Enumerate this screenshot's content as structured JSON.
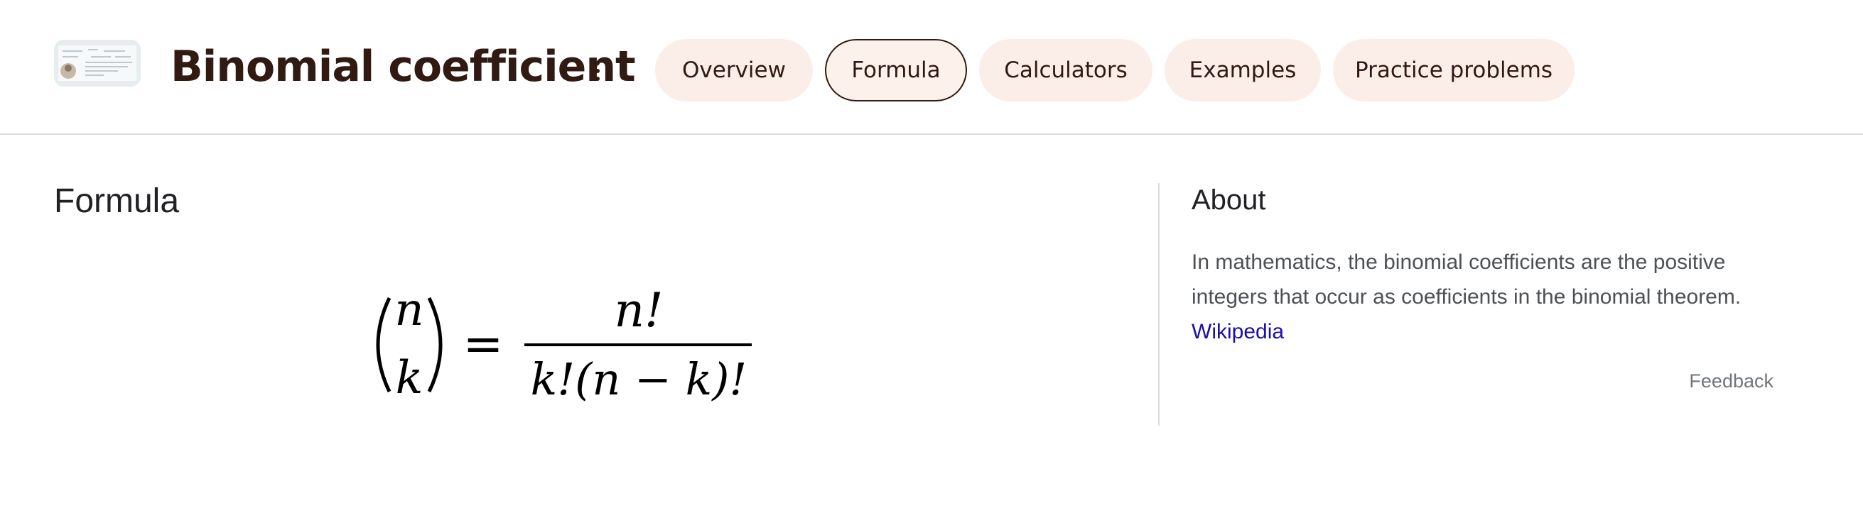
{
  "header": {
    "title": "Binomial coefficient",
    "tabs": [
      {
        "label": "Overview",
        "active": false
      },
      {
        "label": "Formula",
        "active": true
      },
      {
        "label": "Calculators",
        "active": false
      },
      {
        "label": "Examples",
        "active": false
      },
      {
        "label": "Practice problems",
        "active": false
      }
    ]
  },
  "main": {
    "section_title": "Formula",
    "formula": {
      "binom_top": "n",
      "binom_bottom": "k",
      "equals": "=",
      "numerator": "n!",
      "denominator": "k!(n − k)!"
    }
  },
  "about": {
    "title": "About",
    "description": "In mathematics, the binomial coefficients are the positive integers that occur as coefficients in the binomial theorem.",
    "source_link": "Wikipedia",
    "feedback": "Feedback"
  },
  "colors": {
    "title": "#301a12",
    "chip_background": "#fbeee8",
    "link": "#1a0dab",
    "divider": "#dadce0"
  }
}
